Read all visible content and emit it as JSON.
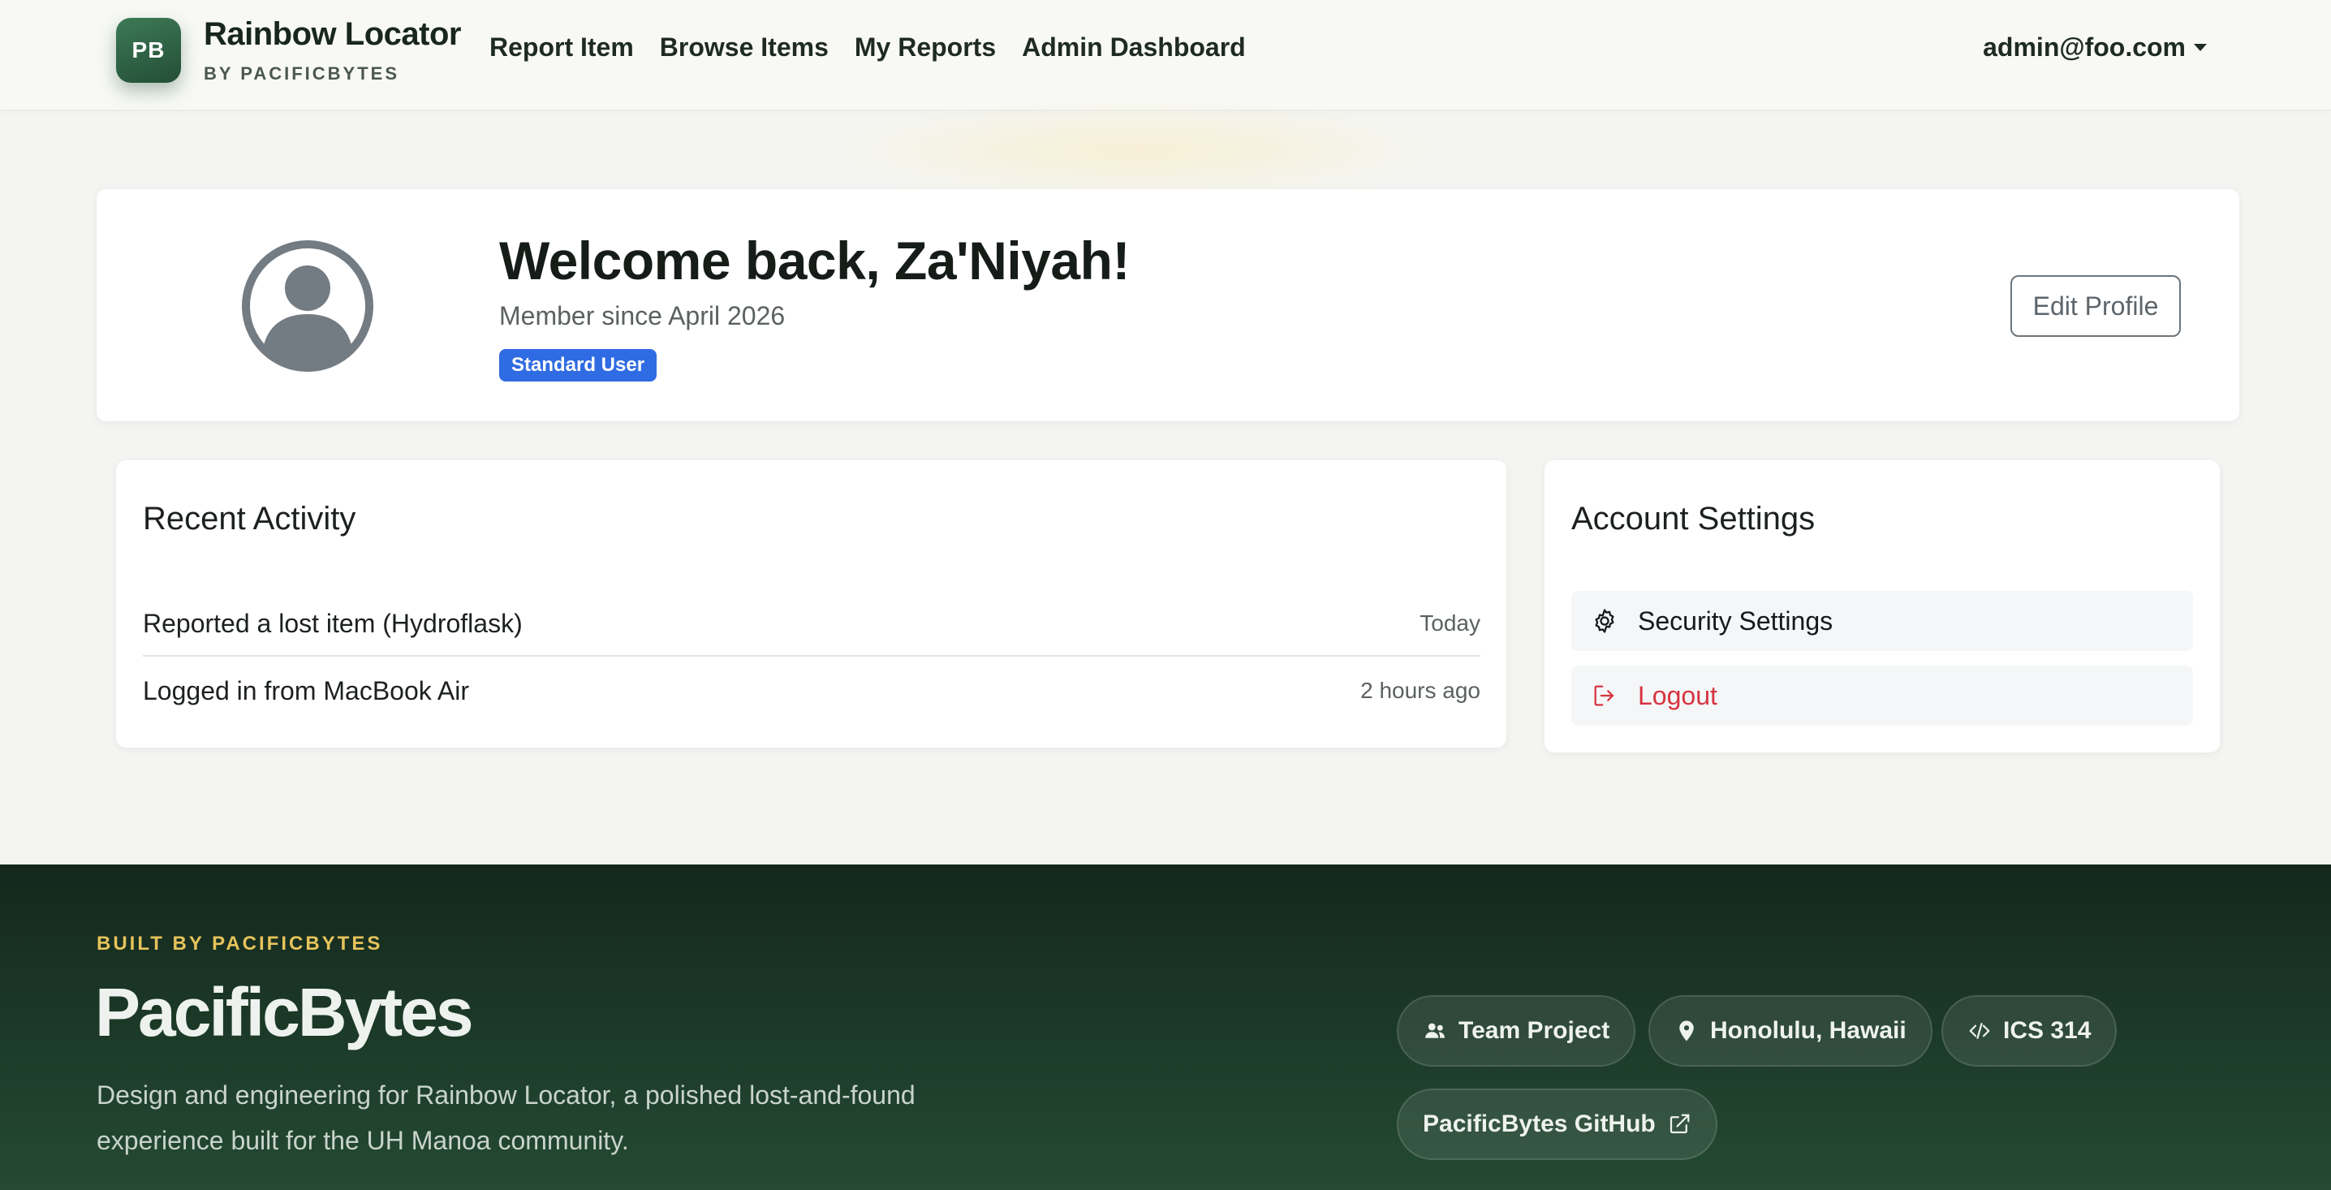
{
  "navbar": {
    "badge": "PB",
    "brand_title": "Rainbow Locator",
    "brand_sub": "BY PACIFICBYTES",
    "links": [
      {
        "label": "Report Item"
      },
      {
        "label": "Browse Items"
      },
      {
        "label": "My Reports"
      },
      {
        "label": "Admin Dashboard"
      }
    ],
    "user": "admin@foo.com"
  },
  "profile": {
    "welcome": "Welcome back, Za'Niyah!",
    "member_since": "Member since April 2026",
    "role_badge": "Standard User",
    "edit_label": "Edit Profile"
  },
  "activity": {
    "heading": "Recent Activity",
    "items": [
      {
        "text": "Reported a lost item (Hydroflask)",
        "time": "Today"
      },
      {
        "text": "Logged in from MacBook Air",
        "time": "2 hours ago"
      }
    ]
  },
  "settings": {
    "heading": "Account Settings",
    "items": [
      {
        "label": "Security Settings",
        "icon": "gear-icon"
      },
      {
        "label": "Logout",
        "icon": "logout-icon"
      }
    ]
  },
  "footer": {
    "kicker": "BUILT BY PACIFICBYTES",
    "title": "PacificBytes",
    "description": "Design and engineering for Rainbow Locator, a polished lost-and-found experience built for the UH Manoa community.",
    "pills": [
      {
        "label": "Team Project",
        "icon": "people-icon"
      },
      {
        "label": "Honolulu, Hawaii",
        "icon": "location-pin-icon"
      },
      {
        "label": "ICS 314",
        "icon": "code-icon"
      },
      {
        "label": "PacificBytes GitHub",
        "icon": "external-link-icon"
      }
    ]
  },
  "colors": {
    "brand_green": "#2f6b48",
    "badge_blue": "#2f6be3",
    "danger": "#d63440",
    "footer_bg": "#1a3425",
    "accent_gold": "#e6c35a"
  }
}
